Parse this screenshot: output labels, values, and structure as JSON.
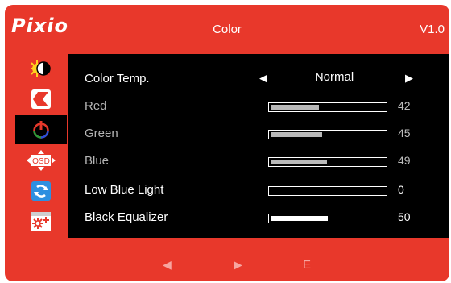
{
  "header": {
    "brand": "Pixio",
    "title": "Color",
    "version": "V1.0"
  },
  "sidebar": {
    "items": [
      {
        "name": "brightness-contrast",
        "icon": "brightness-contrast-icon"
      },
      {
        "name": "input-source",
        "icon": "input-source-icon"
      },
      {
        "name": "color",
        "icon": "color-icon",
        "active": true
      },
      {
        "name": "osd",
        "icon": "osd-settings-icon",
        "text": "OSD"
      },
      {
        "name": "reset",
        "icon": "reset-icon"
      },
      {
        "name": "other",
        "icon": "other-settings-icon"
      }
    ]
  },
  "menu": {
    "color_temp": {
      "label": "Color Temp.",
      "value": "Normal",
      "left_arrow": "◀",
      "right_arrow": "▶"
    },
    "red": {
      "label": "Red",
      "value": "42",
      "level": 42
    },
    "green": {
      "label": "Green",
      "value": "45",
      "level": 45
    },
    "blue": {
      "label": "Blue",
      "value": "49",
      "level": 49
    },
    "low_blue": {
      "label": "Low Blue Light",
      "value": "0",
      "level": 0
    },
    "black_eq": {
      "label": "Black Equalizer",
      "value": "50",
      "level": 50
    }
  },
  "footer": {
    "left": "◀",
    "right": "▶",
    "exit": "E"
  },
  "colors": {
    "frame": "#e8382b",
    "panel": "#000000",
    "text": "#ffffff",
    "dim_text": "#b5b5b5",
    "bar_fill": "#b9b9b9",
    "footer_text": "#f7a5a0"
  }
}
